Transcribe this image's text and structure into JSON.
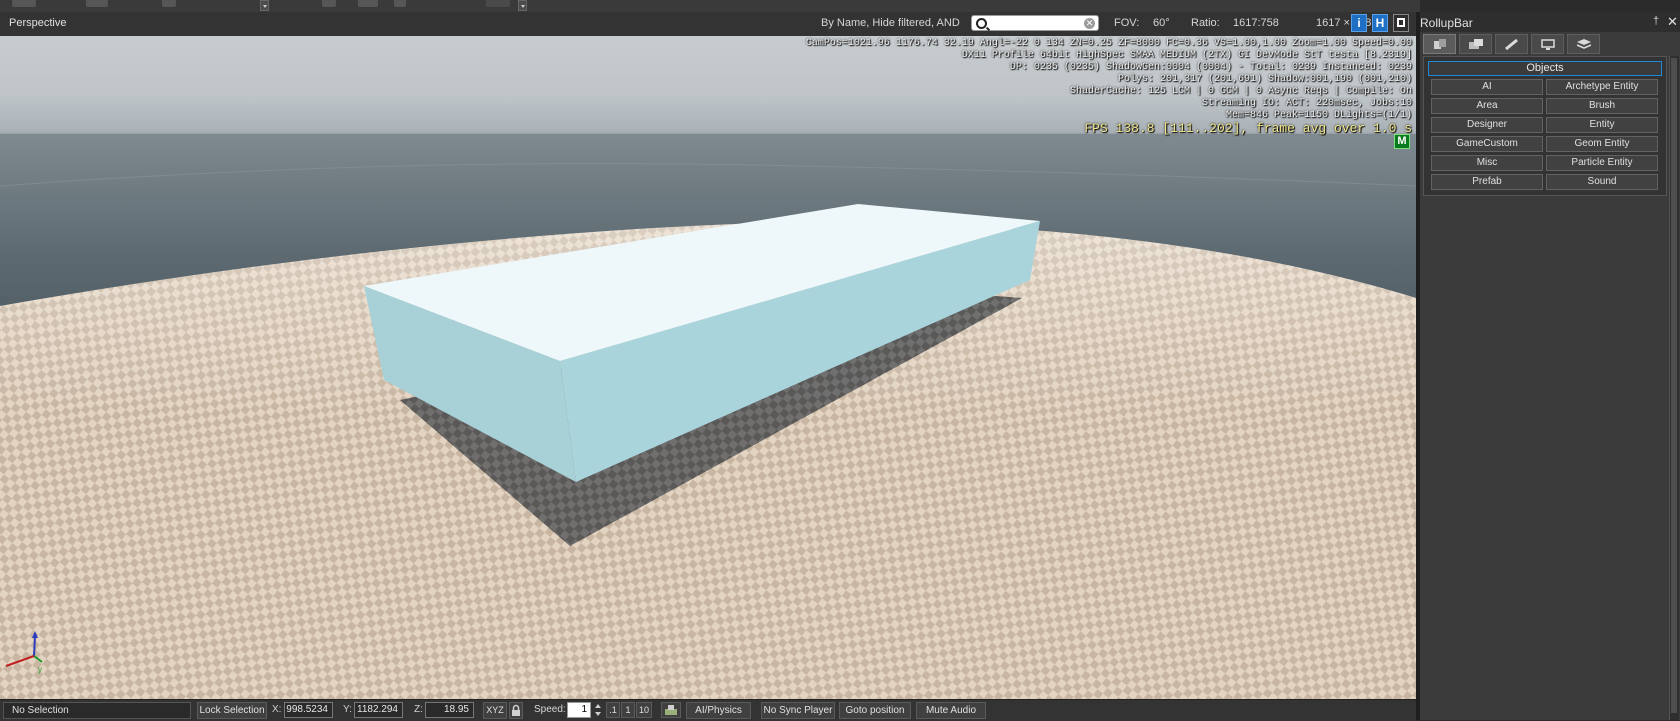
{
  "viewport": {
    "title": "Perspective",
    "filter_label": "By Name, Hide filtered, AND",
    "search": {
      "value": "",
      "placeholder": ""
    },
    "fov_label": "FOV:",
    "fov_value": "60°",
    "ratio_label": "Ratio:",
    "ratio_value": "1617:758",
    "resolution": "1617 × 758",
    "buttons": {
      "info": "i",
      "helpers": "H"
    }
  },
  "hud": {
    "lines": [
      "CamPos=1021.96 1176.74 32.19 Angl=-22  0 134 ZN=0.25 ZF=8000 FC=0.36 VS=1.00,1.00 Zoom=1.00 Speed=0.00",
      "DX11 Profile 64bit HighSpec SMAA MEDIUM (2TX) GI DevMode StT testa [8.2319]",
      "DP: 0235 (0235) ShadowGen:0004 (0004) - Total: 0239 Instanced: 0239",
      "Polys: 201,317 (201,691) Shadow:001,190 (001,210)",
      "ShaderCache: 125 LCM | 0 GCM | 0 Async Reqs | Compile: On",
      "Streaming IO: ACT: 220msec, Jobs:10",
      "Mem=846 Peak=1150 DLights=(1/1)"
    ],
    "fps": "FPS 138.8 [111..202], frame avg over 1.0 s",
    "m_badge": "M"
  },
  "gizmo": {
    "y_label": "y"
  },
  "rollup": {
    "title": "RollupBar",
    "pin": "†",
    "close": "✕",
    "tabs": [
      "objects-tab-icon",
      "terrain-tab-icon",
      "modify-tab-icon",
      "display-tab-icon",
      "layers-tab-icon"
    ],
    "objects_header": "Objects",
    "buttons": [
      "AI",
      "Archetype Entity",
      "Area",
      "Brush",
      "Designer",
      "Entity",
      "GameCustom",
      "Geom Entity",
      "Misc",
      "Particle Entity",
      "Prefab",
      "Sound"
    ]
  },
  "statusbar": {
    "selection": "No Selection",
    "lock_selection": "Lock Selection",
    "x_label": "X:",
    "x_value": "998.5234",
    "y_label": "Y:",
    "y_value": "1182.294",
    "z_label": "Z:",
    "z_value": "18.95",
    "xyz": "XYZ",
    "speed_label": "Speed:",
    "speed_value": "1",
    "speed_presets": [
      ".1",
      "1",
      "10"
    ],
    "ai_physics": "AI/Physics",
    "no_sync_player": "No Sync Player",
    "goto_position": "Goto position",
    "mute_audio": "Mute Audio"
  },
  "colors": {
    "accent": "#1f6fc4",
    "fps_text": "#f0e68c",
    "box_top": "#eef8fa",
    "box_side": "#a9d3da",
    "floor_light": "#e6d7c6",
    "floor_dark": "#c9b7a3"
  }
}
